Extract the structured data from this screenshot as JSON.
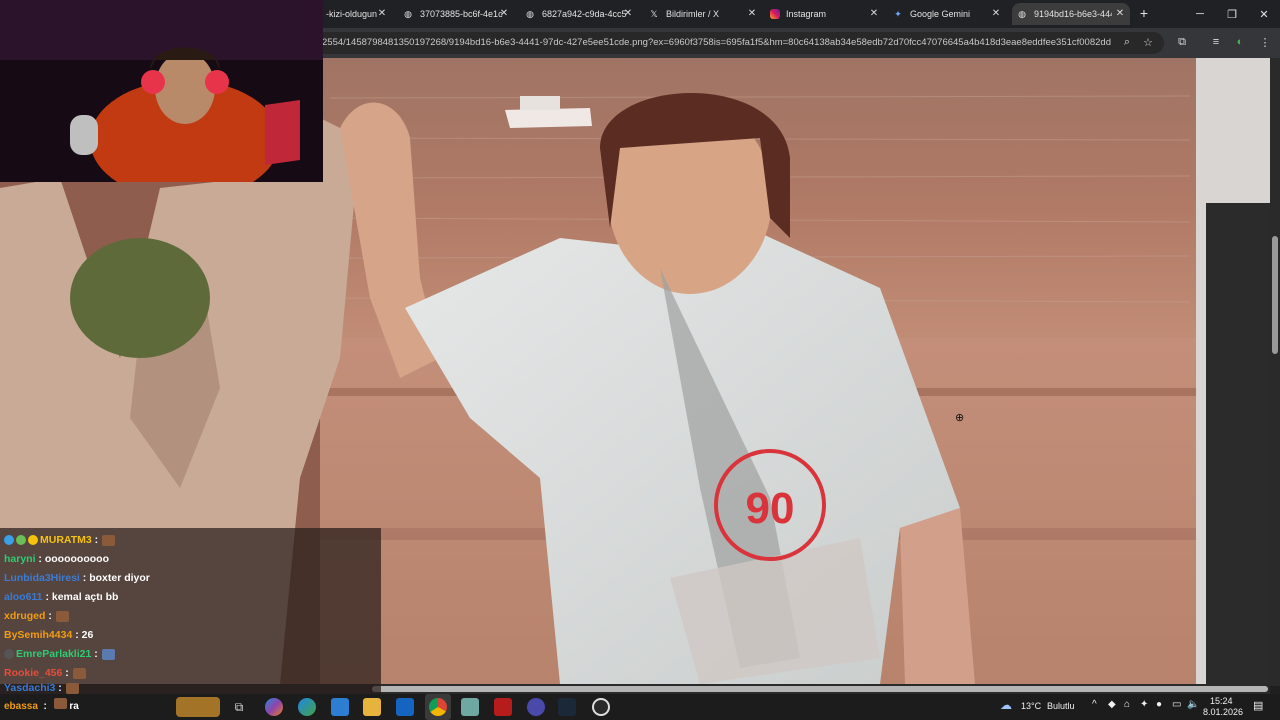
{
  "browser": {
    "tabs": [
      {
        "label": "-kizi-oldugun",
        "icon": "page-icon"
      },
      {
        "label": "37073885-bc6f-4e1c",
        "icon": "globe-icon"
      },
      {
        "label": "6827a942-c9da-4cc5",
        "icon": "globe-icon"
      },
      {
        "label": "Bildirimler / X",
        "icon": "x-logo-icon"
      },
      {
        "label": "Instagram",
        "icon": "instagram-icon"
      },
      {
        "label": "Google Gemini",
        "icon": "gemini-icon"
      },
      {
        "label": "9194bd16-b6e3-444",
        "icon": "globe-icon",
        "active": true
      }
    ],
    "url": "2554/1458798481350197268/9194bd16-b6e3-4441-97dc-427e5ee51cde.png?ex=6960f3758is=695fa1f5&hm=80c64138ab34e58edb72d70fcc47076645a4b418d3eae8eddfee351cf0082dd",
    "accent_color": "#35363a"
  },
  "viewer": {
    "cursor_icon": "zoom-in-icon",
    "shirt_print": "90"
  },
  "chat": {
    "messages": [
      {
        "user": "MURATM3",
        "text": "",
        "user_color": "#f4c20d",
        "badges": [
          "diamond-badge",
          "globe-badge",
          "sub-badge"
        ],
        "emote": true
      },
      {
        "user": "haryni",
        "text": "oooooooooo",
        "user_color": "#2ecc71"
      },
      {
        "user": "Lunbida3Hiresi",
        "text": "boxter diyor",
        "user_color": "#3a7bd5"
      },
      {
        "user": "aloo611",
        "text": "kemal açtı bb",
        "user_color": "#3a7bd5"
      },
      {
        "user": "xdruged",
        "text": "",
        "user_color": "#f39c12",
        "emote": true
      },
      {
        "user": "BySemih4434",
        "text": "26",
        "user_color": "#f39c12"
      },
      {
        "user": "EmreParlakli21",
        "text": "",
        "user_color": "#2ecc71",
        "badges": [
          "circle-badge"
        ],
        "emote": true
      },
      {
        "user": "Rookie_456",
        "text": "",
        "user_color": "#e74c3c",
        "emote": true
      },
      {
        "user": "Yasdachi3",
        "text": "",
        "user_color": "#3a7bd5",
        "emote": true
      },
      {
        "user": "ebassa",
        "text": "ra",
        "user_color": "#f39c12",
        "emote": true
      }
    ]
  },
  "taskbar": {
    "weather_temp": "13°C",
    "weather_desc": "Bulutlu",
    "time": "15:24",
    "date": "8.01.2026"
  }
}
